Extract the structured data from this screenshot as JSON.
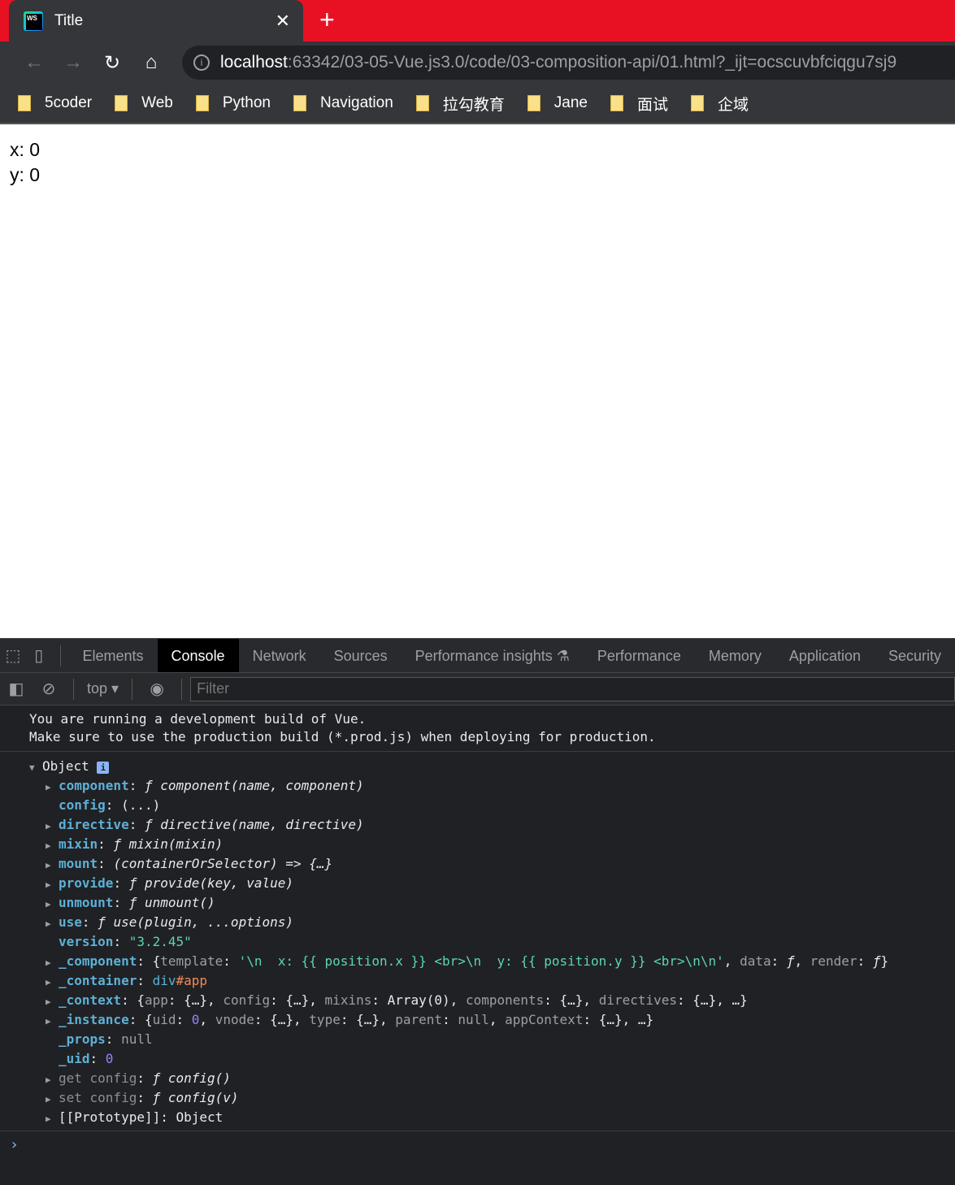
{
  "browser": {
    "tab_title": "Title",
    "url_host": "localhost",
    "url_rest": ":63342/03-05-Vue.js3.0/code/03-composition-api/01.html?_ijt=ocscuvbfciqgu7sj9",
    "bookmarks": [
      "5coder",
      "Web",
      "Python",
      "Navigation",
      "拉勾教育",
      "Jane",
      "面试",
      "企域"
    ]
  },
  "page": {
    "x_line": "x: 0",
    "y_line": "y: 0"
  },
  "devtools": {
    "tabs": [
      "Elements",
      "Console",
      "Network",
      "Sources",
      "Performance insights ⚗",
      "Performance",
      "Memory",
      "Application",
      "Security"
    ],
    "context": "top",
    "filter_placeholder": "Filter",
    "message": "You are running a development build of Vue.\nMake sure to use the production build (*.prod.js) when deploying for production.",
    "object_label": "Object",
    "lines": [
      [
        [
          "k",
          "component"
        ],
        [
          "w",
          ": "
        ],
        [
          "i",
          "ƒ component(name, component)"
        ]
      ],
      [
        [
          "k",
          "config"
        ],
        [
          "w",
          ": (...)"
        ]
      ],
      [
        [
          "k",
          "directive"
        ],
        [
          "w",
          ": "
        ],
        [
          "i",
          "ƒ directive(name, directive)"
        ]
      ],
      [
        [
          "k",
          "mixin"
        ],
        [
          "w",
          ": "
        ],
        [
          "i",
          "ƒ mixin(mixin)"
        ]
      ],
      [
        [
          "k",
          "mount"
        ],
        [
          "w",
          ": "
        ],
        [
          "i",
          "(containerOrSelector) => {…}"
        ]
      ],
      [
        [
          "k",
          "provide"
        ],
        [
          "w",
          ": "
        ],
        [
          "i",
          "ƒ provide(key, value)"
        ]
      ],
      [
        [
          "k",
          "unmount"
        ],
        [
          "w",
          ": "
        ],
        [
          "i",
          "ƒ unmount()"
        ]
      ],
      [
        [
          "k",
          "use"
        ],
        [
          "w",
          ": "
        ],
        [
          "i",
          "ƒ use(plugin, ...options)"
        ]
      ],
      [
        [
          "k",
          "version"
        ],
        [
          "w",
          ": "
        ],
        [
          "s",
          "\"3.2.45\""
        ]
      ],
      [
        [
          "k",
          "_component"
        ],
        [
          "w",
          ": {"
        ],
        [
          "g",
          "template"
        ],
        [
          "w",
          ": "
        ],
        [
          "s",
          "'\\n  x: {{ position.x }} <br>\\n  y: {{ position.y }} <br>\\n\\n'"
        ],
        [
          "w",
          ", "
        ],
        [
          "g",
          "data"
        ],
        [
          "w",
          ": "
        ],
        [
          "i",
          "ƒ"
        ],
        [
          "w",
          ", "
        ],
        [
          "g",
          "render"
        ],
        [
          "w",
          ": "
        ],
        [
          "i",
          "ƒ"
        ],
        [
          "w",
          "}"
        ]
      ],
      [
        [
          "k",
          "_container"
        ],
        [
          "w",
          ": "
        ],
        [
          "d",
          "div"
        ],
        [
          "o",
          "#app"
        ]
      ],
      [
        [
          "k",
          "_context"
        ],
        [
          "w",
          ": {"
        ],
        [
          "g",
          "app"
        ],
        [
          "w",
          ": {…}, "
        ],
        [
          "g",
          "config"
        ],
        [
          "w",
          ": {…}, "
        ],
        [
          "g",
          "mixins"
        ],
        [
          "w",
          ": Array(0), "
        ],
        [
          "g",
          "components"
        ],
        [
          "w",
          ": {…}, "
        ],
        [
          "g",
          "directives"
        ],
        [
          "w",
          ": {…}, …}"
        ]
      ],
      [
        [
          "k",
          "_instance"
        ],
        [
          "w",
          ": {"
        ],
        [
          "g",
          "uid"
        ],
        [
          "w",
          ": "
        ],
        [
          "n",
          "0"
        ],
        [
          "w",
          ", "
        ],
        [
          "g",
          "vnode"
        ],
        [
          "w",
          ": {…}, "
        ],
        [
          "g",
          "type"
        ],
        [
          "w",
          ": {…}, "
        ],
        [
          "g",
          "parent"
        ],
        [
          "w",
          ": "
        ],
        [
          "g",
          "null"
        ],
        [
          "w",
          ", "
        ],
        [
          "g",
          "appContext"
        ],
        [
          "w",
          ": {…}, …}"
        ]
      ],
      [
        [
          "k",
          "_props"
        ],
        [
          "w",
          ": "
        ],
        [
          "g",
          "null"
        ]
      ],
      [
        [
          "k",
          "_uid"
        ],
        [
          "w",
          ": "
        ],
        [
          "n",
          "0"
        ]
      ],
      [
        [
          "kg",
          "get config"
        ],
        [
          "w",
          ": "
        ],
        [
          "i",
          "ƒ config()"
        ]
      ],
      [
        [
          "kg",
          "set config"
        ],
        [
          "w",
          ": "
        ],
        [
          "i",
          "ƒ config(v)"
        ]
      ],
      [
        [
          "w",
          "[[Prototype]]: Object"
        ]
      ]
    ],
    "expandable": [
      true,
      false,
      true,
      true,
      true,
      true,
      true,
      true,
      false,
      true,
      true,
      true,
      true,
      false,
      false,
      true,
      true,
      true
    ]
  }
}
